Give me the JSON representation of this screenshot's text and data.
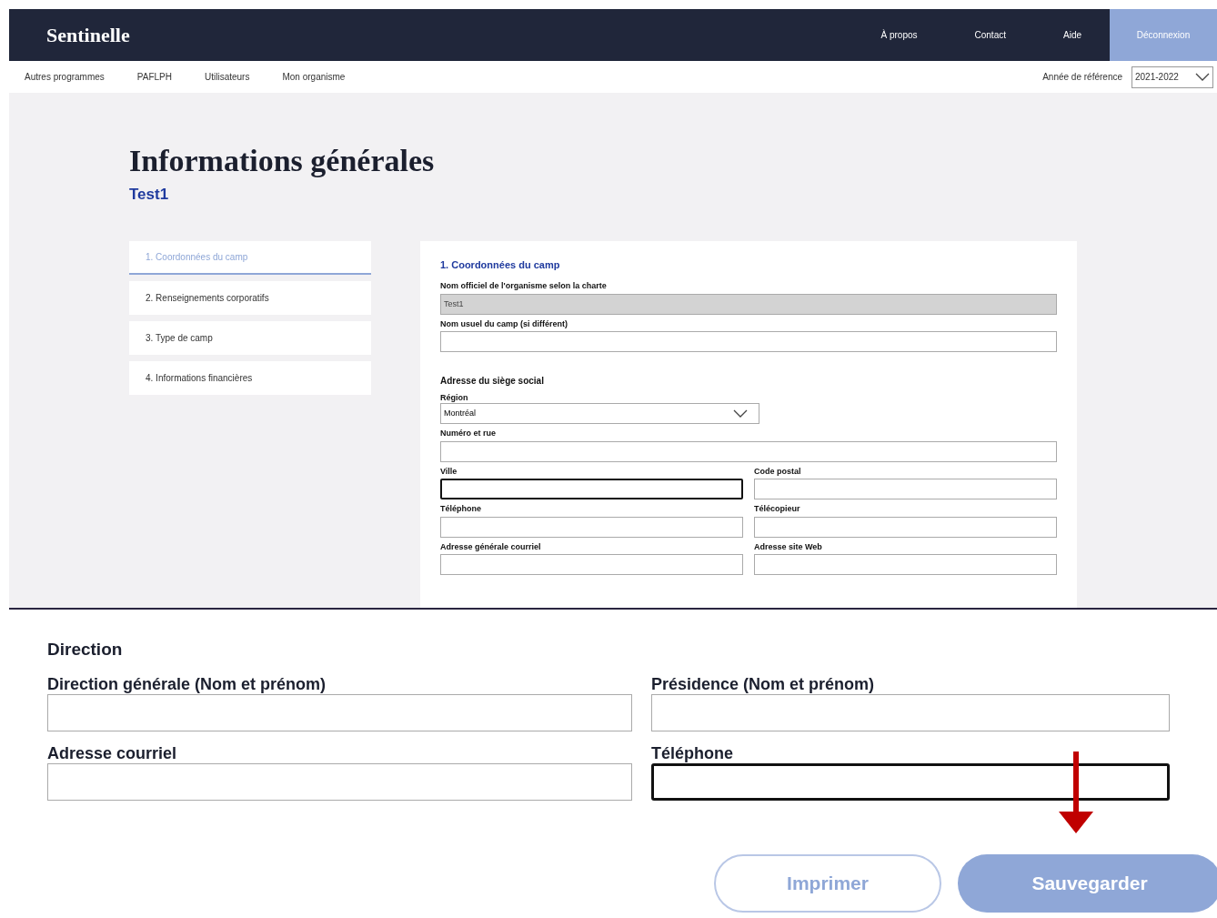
{
  "header": {
    "logo": "Sentinelle",
    "links": [
      {
        "label": "À propos",
        "kind": "link"
      },
      {
        "label": "Contact",
        "kind": "link"
      },
      {
        "label": "Aide",
        "kind": "link"
      },
      {
        "label": "Déconnexion",
        "kind": "button"
      }
    ]
  },
  "subnav": {
    "items": [
      "Autres programmes",
      "PAFLPH",
      "Utilisateurs",
      "Mon organisme"
    ],
    "year_label": "Année de référence",
    "year_value": "2021-2022"
  },
  "page": {
    "title": "Informations générales",
    "subtitle": "Test1"
  },
  "steps": [
    {
      "label": "1. Coordonnées du camp",
      "selected": true
    },
    {
      "label": "2. Renseignements corporatifs",
      "selected": false
    },
    {
      "label": "3. Type de camp",
      "selected": false
    },
    {
      "label": "4. Informations financières",
      "selected": false
    }
  ],
  "form": {
    "heading": "1. Coordonnées du camp",
    "sections": [
      {
        "rows": [
          [
            {
              "label": "Nom officiel de l'organisme selon la charte",
              "kind": "text",
              "value": "Test1",
              "disabled": true,
              "focused": false
            }
          ],
          [
            {
              "label": "Nom usuel du camp (si différent)",
              "kind": "text",
              "disabled": false,
              "focused": false
            }
          ]
        ]
      },
      {
        "title": "Adresse du siège social",
        "rows": [
          [
            {
              "label": "Région",
              "kind": "select",
              "value": "Montréal",
              "disabled": false,
              "focused": false
            }
          ],
          [
            {
              "label": "Numéro et rue",
              "kind": "text",
              "disabled": false,
              "focused": false
            }
          ],
          [
            {
              "label": "Ville",
              "kind": "text",
              "disabled": false,
              "focused": true
            },
            {
              "label": "Code postal",
              "kind": "text",
              "disabled": false,
              "focused": false
            }
          ],
          [
            {
              "label": "Téléphone",
              "kind": "text",
              "disabled": false,
              "focused": false
            },
            {
              "label": "Télécopieur",
              "kind": "text",
              "disabled": false,
              "focused": false
            }
          ],
          [
            {
              "label": "Adresse générale courriel",
              "kind": "text",
              "disabled": false,
              "focused": false
            },
            {
              "label": "Adresse site Web",
              "kind": "text",
              "disabled": false,
              "focused": false
            }
          ]
        ]
      }
    ]
  },
  "zoom_panel": {
    "title": "Direction",
    "rows": [
      [
        {
          "label": "Direction générale (Nom et prénom)",
          "focused": false
        },
        {
          "label": "Présidence (Nom et prénom)",
          "focused": false
        }
      ],
      [
        {
          "label": "Adresse courriel",
          "focused": false
        },
        {
          "label": "Téléphone",
          "focused": true
        }
      ]
    ]
  },
  "buttons": [
    {
      "label": "Imprimer",
      "kind": "secondary"
    },
    {
      "label": "Sauvegarder",
      "kind": "primary"
    }
  ]
}
